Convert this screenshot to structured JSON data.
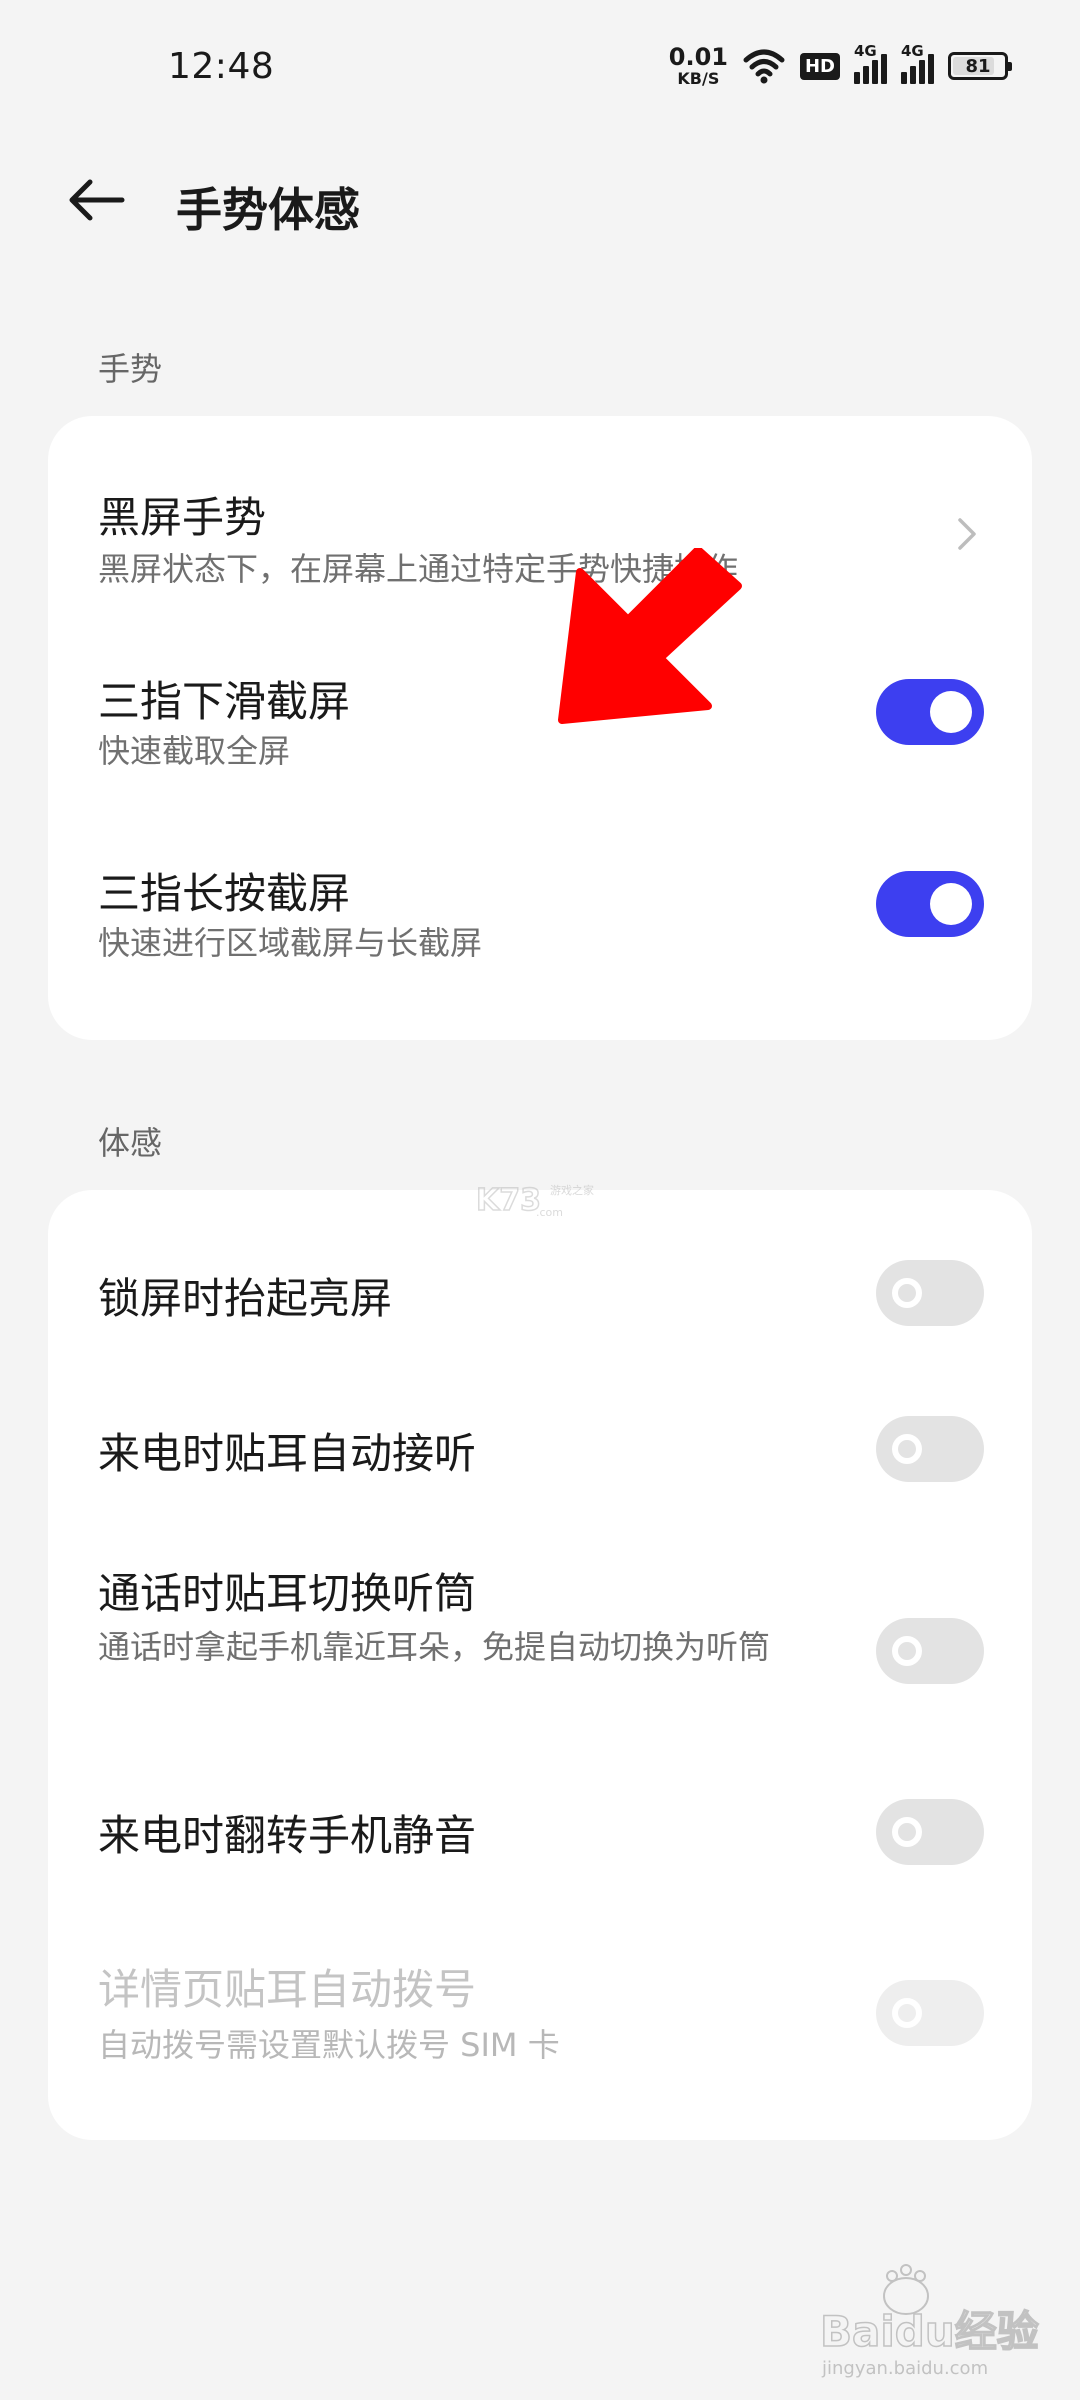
{
  "status_bar": {
    "time": "12:48",
    "net_speed_value": "0.01",
    "net_speed_unit": "KB/S",
    "hd_label": "HD",
    "signal1_label": "4G",
    "signal2_label": "4G",
    "battery_level": "81"
  },
  "header": {
    "title": "手势体感"
  },
  "section_gesture": {
    "label": "手势",
    "items": [
      {
        "title": "黑屏手势",
        "subtitle": "黑屏状态下，在屏幕上通过特定手势快捷操作"
      },
      {
        "title": "三指下滑截屏",
        "subtitle": "快速截取全屏",
        "toggle": "on"
      },
      {
        "title": "三指长按截屏",
        "subtitle": "快速进行区域截屏与长截屏",
        "toggle": "on"
      }
    ]
  },
  "section_motion": {
    "label": "体感",
    "items": [
      {
        "title": "锁屏时抬起亮屏",
        "toggle": "off"
      },
      {
        "title": "来电时贴耳自动接听",
        "toggle": "off"
      },
      {
        "title": "通话时贴耳切换听筒",
        "subtitle": "通话时拿起手机靠近耳朵，免提自动切换为听筒",
        "toggle": "off"
      },
      {
        "title": "来电时翻转手机静音",
        "toggle": "off"
      },
      {
        "title": "详情页贴耳自动拨号",
        "subtitle": "自动拨号需设置默认拨号 SIM 卡",
        "toggle": "off",
        "disabled": true
      }
    ]
  },
  "watermarks": {
    "k73": "K73",
    "k73_sub": "游戏之家",
    "k73_domain": ".com",
    "baidu": "Baidu经验",
    "baidu_domain": "jingyan.baidu.com"
  },
  "colors": {
    "accent": "#3d3ff0",
    "annotation_arrow": "#ff0000",
    "background": "#f4f4f4",
    "card": "#ffffff"
  },
  "icons": {
    "back": "arrow-left-icon",
    "chevron": "chevron-right-icon",
    "wifi": "wifi-icon",
    "battery": "battery-icon"
  }
}
